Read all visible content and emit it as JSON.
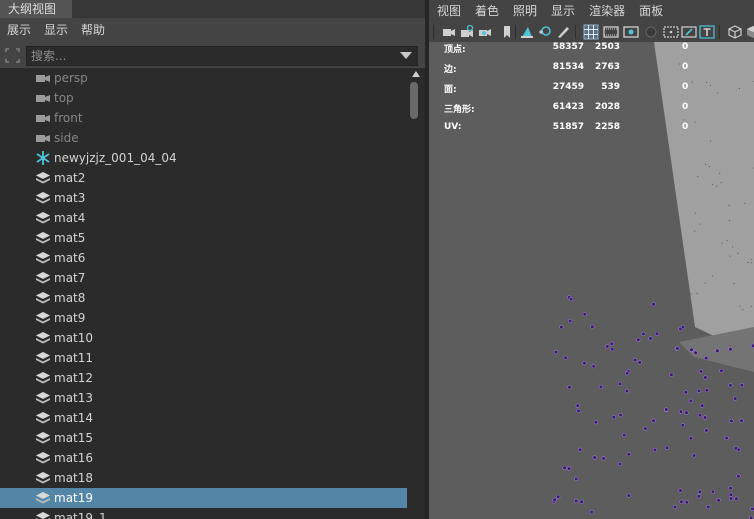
{
  "outliner": {
    "tab_title": "大纲视图",
    "menu": [
      "展示",
      "显示",
      "帮助"
    ],
    "search": {
      "placeholder": "搜索...",
      "value": ""
    },
    "items": [
      {
        "label": "persp",
        "type": "camera",
        "selected": false
      },
      {
        "label": "top",
        "type": "camera",
        "selected": false
      },
      {
        "label": "front",
        "type": "camera",
        "selected": false
      },
      {
        "label": "side",
        "type": "camera",
        "selected": false
      },
      {
        "label": "newyjzjz_001_04_04",
        "type": "joint",
        "selected": false
      },
      {
        "label": "mat2",
        "type": "group",
        "selected": false
      },
      {
        "label": "mat3",
        "type": "group",
        "selected": false
      },
      {
        "label": "mat4",
        "type": "group",
        "selected": false
      },
      {
        "label": "mat5",
        "type": "group",
        "selected": false
      },
      {
        "label": "mat6",
        "type": "group",
        "selected": false
      },
      {
        "label": "mat7",
        "type": "group",
        "selected": false
      },
      {
        "label": "mat8",
        "type": "group",
        "selected": false
      },
      {
        "label": "mat9",
        "type": "group",
        "selected": false
      },
      {
        "label": "mat10",
        "type": "group",
        "selected": false
      },
      {
        "label": "mat11",
        "type": "group",
        "selected": false
      },
      {
        "label": "mat12",
        "type": "group",
        "selected": false
      },
      {
        "label": "mat13",
        "type": "group",
        "selected": false
      },
      {
        "label": "mat14",
        "type": "group",
        "selected": false
      },
      {
        "label": "mat15",
        "type": "group",
        "selected": false
      },
      {
        "label": "mat16",
        "type": "group",
        "selected": false
      },
      {
        "label": "mat18",
        "type": "group",
        "selected": false
      },
      {
        "label": "mat19",
        "type": "group",
        "selected": true
      },
      {
        "label": "mat19_1",
        "type": "group",
        "selected": false
      }
    ]
  },
  "viewport": {
    "menu": [
      "视图",
      "着色",
      "照明",
      "显示",
      "渲染器",
      "面板"
    ],
    "toolbar_icons": [
      "camera-icon",
      "camera-lock-icon",
      "camera-attributes-icon",
      "bookmark-icon",
      "image-plane-icon",
      "pan-zoom-icon",
      "grease-pencil-icon",
      "grid-icon",
      "film-gate-icon",
      "resolution-gate-icon",
      "gate-mask-icon",
      "field-chart-icon",
      "safe-action-icon",
      "safe-title-icon",
      "wireframe-cube-icon"
    ],
    "hud": [
      {
        "label": "顶点:",
        "v1": "58357",
        "v2": "2503",
        "v3": "0"
      },
      {
        "label": "边:",
        "v1": "81534",
        "v2": "2763",
        "v3": "0"
      },
      {
        "label": "面:",
        "v1": "27459",
        "v2": "539",
        "v3": "0"
      },
      {
        "label": "三角形:",
        "v1": "61423",
        "v2": "2028",
        "v3": "0"
      },
      {
        "label": "UV:",
        "v1": "51857",
        "v2": "2258",
        "v3": "0"
      }
    ]
  },
  "colors": {
    "panel_bg": "#444444",
    "list_bg": "#2b2b2b",
    "selection": "#5285a6",
    "joint_icon": "#4fc3d9",
    "viewport_bg": "#5d5d5d",
    "plane_light": "#a0a0a0",
    "vertex_dots": "#3a1a6a"
  }
}
